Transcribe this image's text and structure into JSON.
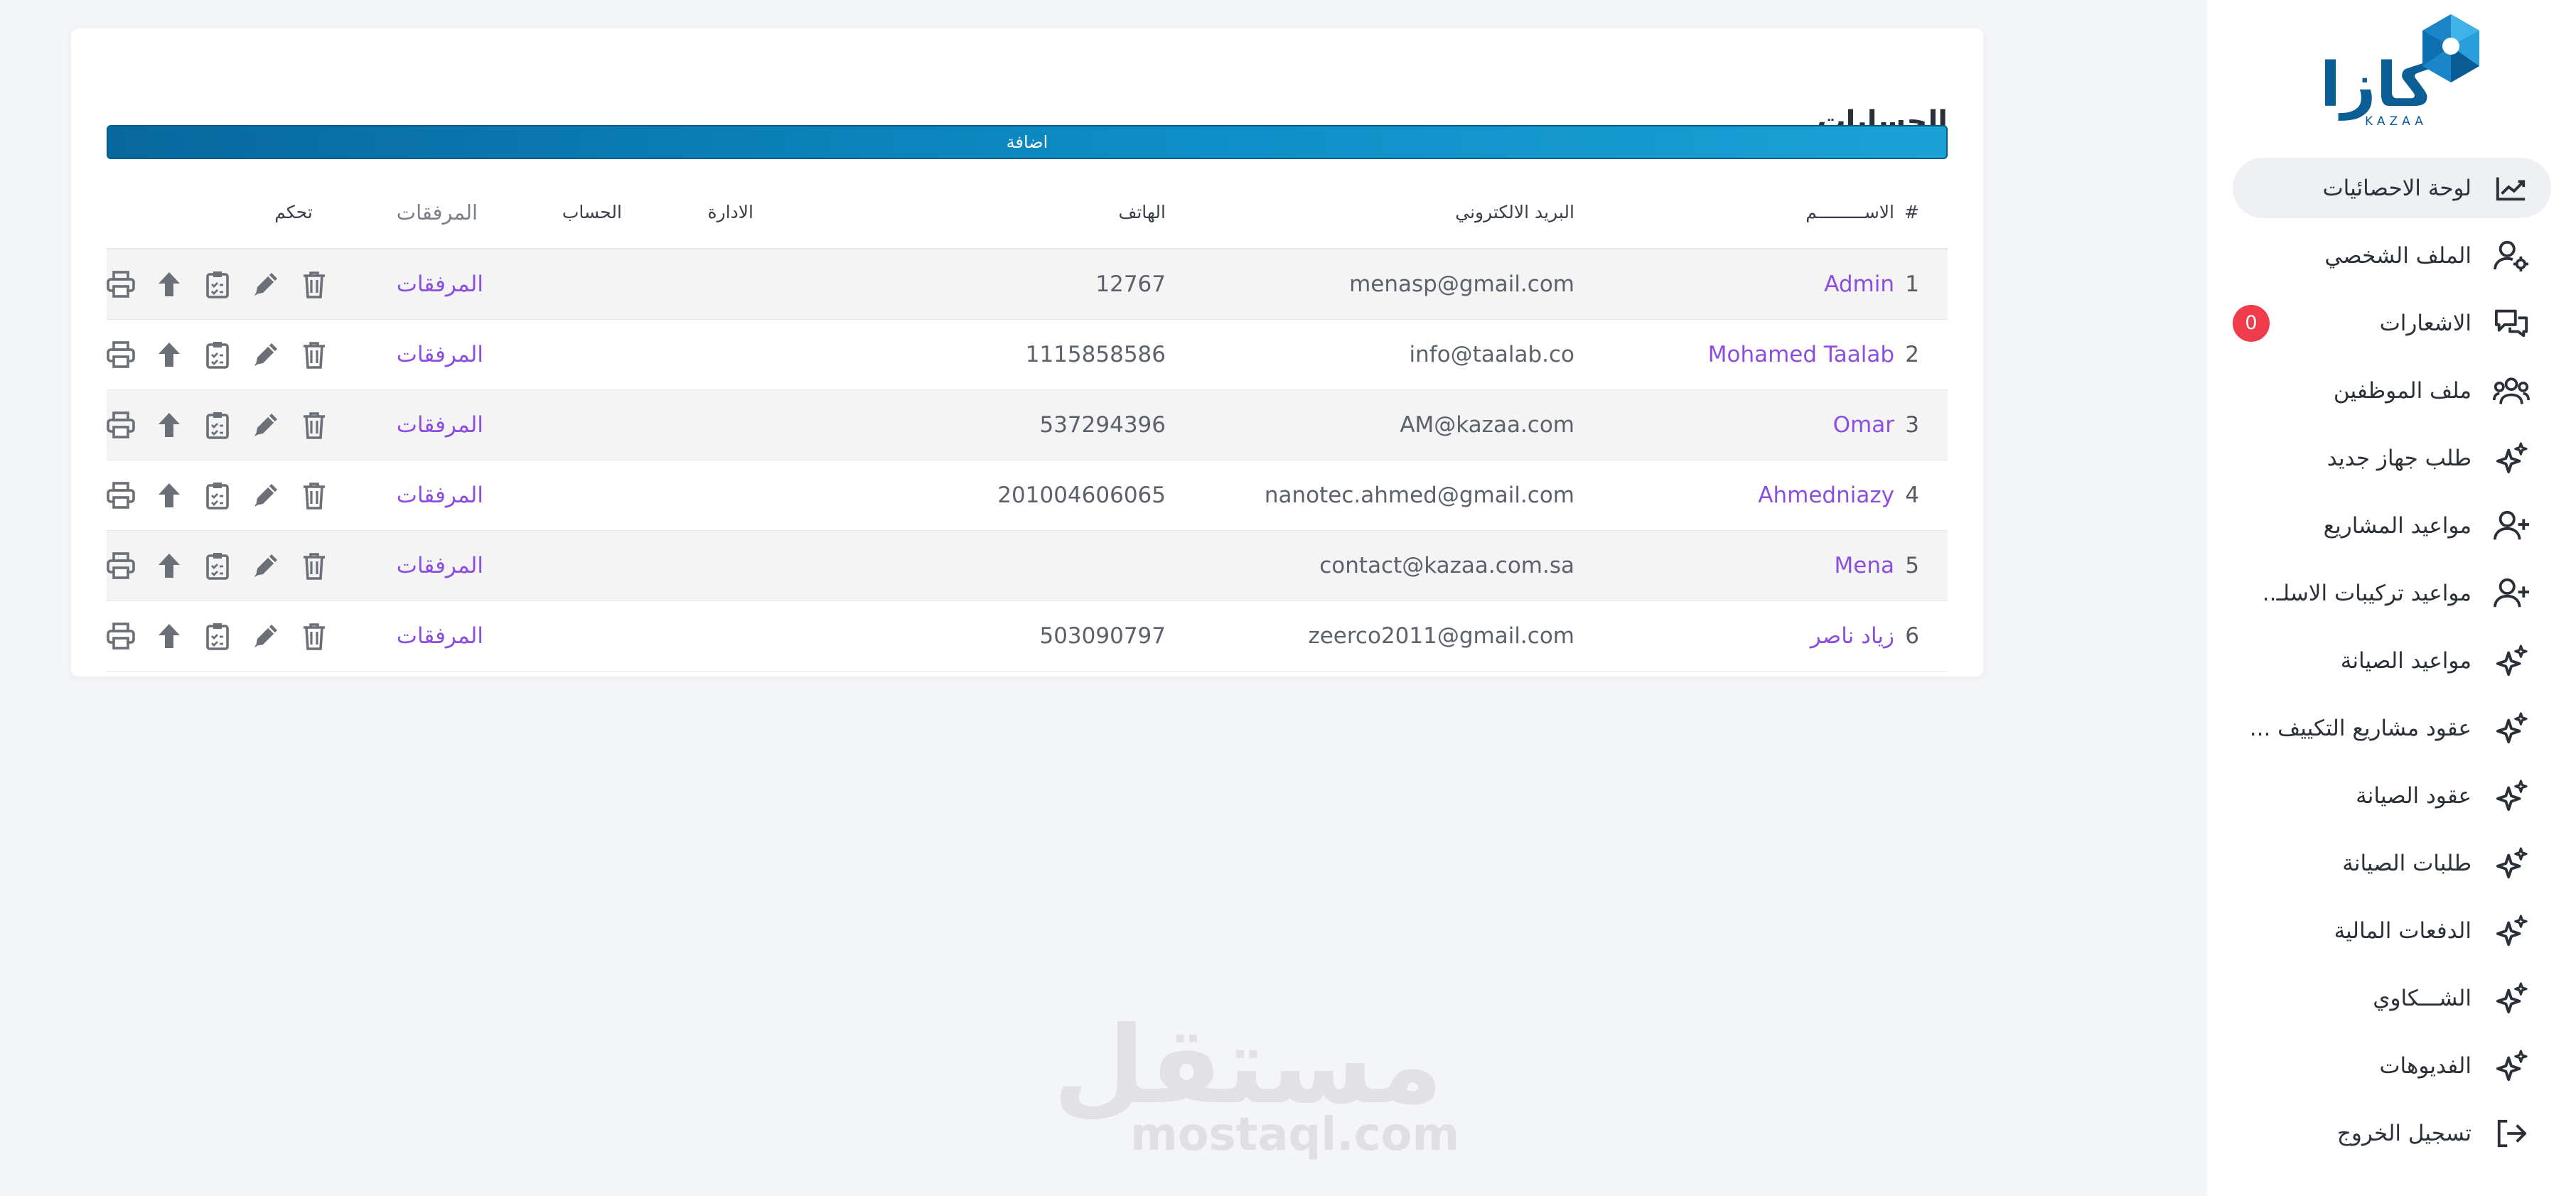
{
  "brand": {
    "logo_text": "كازا",
    "logo_latin": "KAZAA",
    "color": "#0b5d96"
  },
  "sidebar": {
    "items": [
      {
        "label": "لوحة الاحصائيات",
        "icon": "chart-line-icon",
        "active": true
      },
      {
        "label": "الملف الشخصي",
        "icon": "user-gear-icon"
      },
      {
        "label": "الاشعارات",
        "icon": "chat-bubbles-icon",
        "badge": "0"
      },
      {
        "label": "ملف الموظفين",
        "icon": "users-icon"
      },
      {
        "label": "طلب جهاز جديد",
        "icon": "sparkle-icon"
      },
      {
        "label": "مواعيد المشاريع",
        "icon": "user-plus-icon"
      },
      {
        "label": "مواعيد تركيبات الاسلـ..",
        "icon": "user-plus-icon"
      },
      {
        "label": "مواعيد الصيانة",
        "icon": "sparkle-icon"
      },
      {
        "label": "عقود مشاريع التكييف ...",
        "icon": "sparkle-icon"
      },
      {
        "label": "عقود الصيانة",
        "icon": "sparkle-icon"
      },
      {
        "label": "طلبات الصيانة",
        "icon": "sparkle-icon"
      },
      {
        "label": "الدفعات المالية",
        "icon": "sparkle-icon"
      },
      {
        "label": "الشـــكاوي",
        "icon": "sparkle-icon"
      },
      {
        "label": "الفديوهات",
        "icon": "sparkle-icon"
      },
      {
        "label": "تسجيل الخروج",
        "icon": "logout-icon"
      }
    ]
  },
  "page": {
    "title": "الحسابات",
    "add_label": "اضافة"
  },
  "table": {
    "headers": {
      "num": "#",
      "name": "الاســـــــــم",
      "email": "البريد الالكتروني",
      "phone": "الهاتف",
      "dept": "الادارة",
      "account": "الحساب",
      "attachments": "المرفقات",
      "control": "تحكم"
    },
    "rows": [
      {
        "num": "1",
        "name": "Admin",
        "email": "menasp@gmail.com",
        "phone": "12767",
        "dept": "",
        "account": "",
        "attachments": "المرفقات"
      },
      {
        "num": "2",
        "name": "Mohamed Taalab",
        "email": "info@taalab.co",
        "phone": "1115858586",
        "dept": "",
        "account": "",
        "attachments": "المرفقات"
      },
      {
        "num": "3",
        "name": "Omar",
        "email": "AM@kazaa.com",
        "phone": "537294396",
        "dept": "",
        "account": "",
        "attachments": "المرفقات"
      },
      {
        "num": "4",
        "name": "Ahmedniazy",
        "email": "nanotec.ahmed@gmail.com",
        "phone": "201004606065",
        "dept": "",
        "account": "",
        "attachments": "المرفقات"
      },
      {
        "num": "5",
        "name": "Mena",
        "email": "contact@kazaa.com.sa",
        "phone": "",
        "dept": "",
        "account": "",
        "attachments": "المرفقات"
      },
      {
        "num": "6",
        "name": "زياد ناصر",
        "email": "zeerco2011@gmail.com",
        "phone": "503090797",
        "dept": "",
        "account": "",
        "attachments": "المرفقات"
      }
    ],
    "row_actions": [
      "print-icon",
      "upload-arrow-icon",
      "clipboard-icon",
      "pencil-icon",
      "trash-icon"
    ]
  },
  "watermark": {
    "arabic": "مستقل",
    "latin": "mostaql.com"
  },
  "colors": {
    "accent": "#8b4ee0",
    "bar_start": "#07689f",
    "bar_end": "#1aa2d6",
    "badge": "#f03c4a"
  }
}
